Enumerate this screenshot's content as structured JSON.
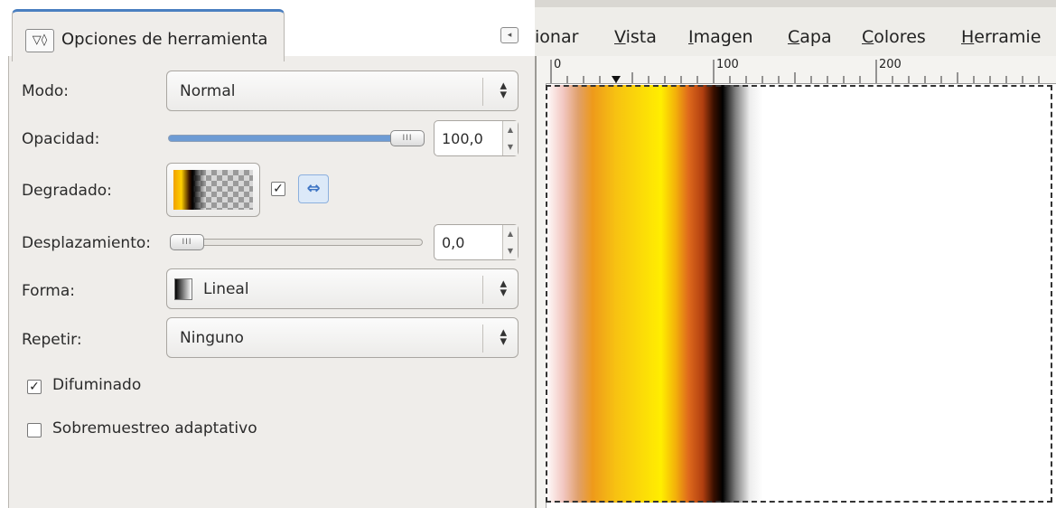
{
  "tool_options": {
    "tab_icon": "tool-options-icon",
    "tab_icon_text": "▽◊",
    "tab_title": "Opciones de herramienta",
    "collapse_icon": "◂",
    "modo": {
      "label": "Modo:",
      "value": "Normal"
    },
    "opacidad": {
      "label": "Opacidad:",
      "value": "100,0",
      "level_percent": 100
    },
    "degradado": {
      "label": "Degradado:",
      "reverse_checked": true
    },
    "desplazamiento": {
      "label": "Desplazamiento:",
      "value": "0,0",
      "level_percent": 0
    },
    "forma": {
      "label": "Forma:",
      "value": "Lineal"
    },
    "repetir": {
      "label": "Repetir:",
      "value": "Ninguno"
    },
    "difuminado": {
      "label": "Difuminado",
      "checked": true
    },
    "sobremuestreo": {
      "label": "Sobremuestreo adaptativo",
      "checked": false
    }
  },
  "menubar": {
    "items": [
      "ionar",
      "Vista",
      "Imagen",
      "Capa",
      "Colores",
      "Herramie"
    ]
  },
  "ruler": {
    "labels": [
      "0",
      "100",
      "200"
    ]
  },
  "colors": {
    "accent": "#4a7fc0",
    "panel_bg": "#efedea",
    "slider_fill": "#6d9bd4"
  }
}
